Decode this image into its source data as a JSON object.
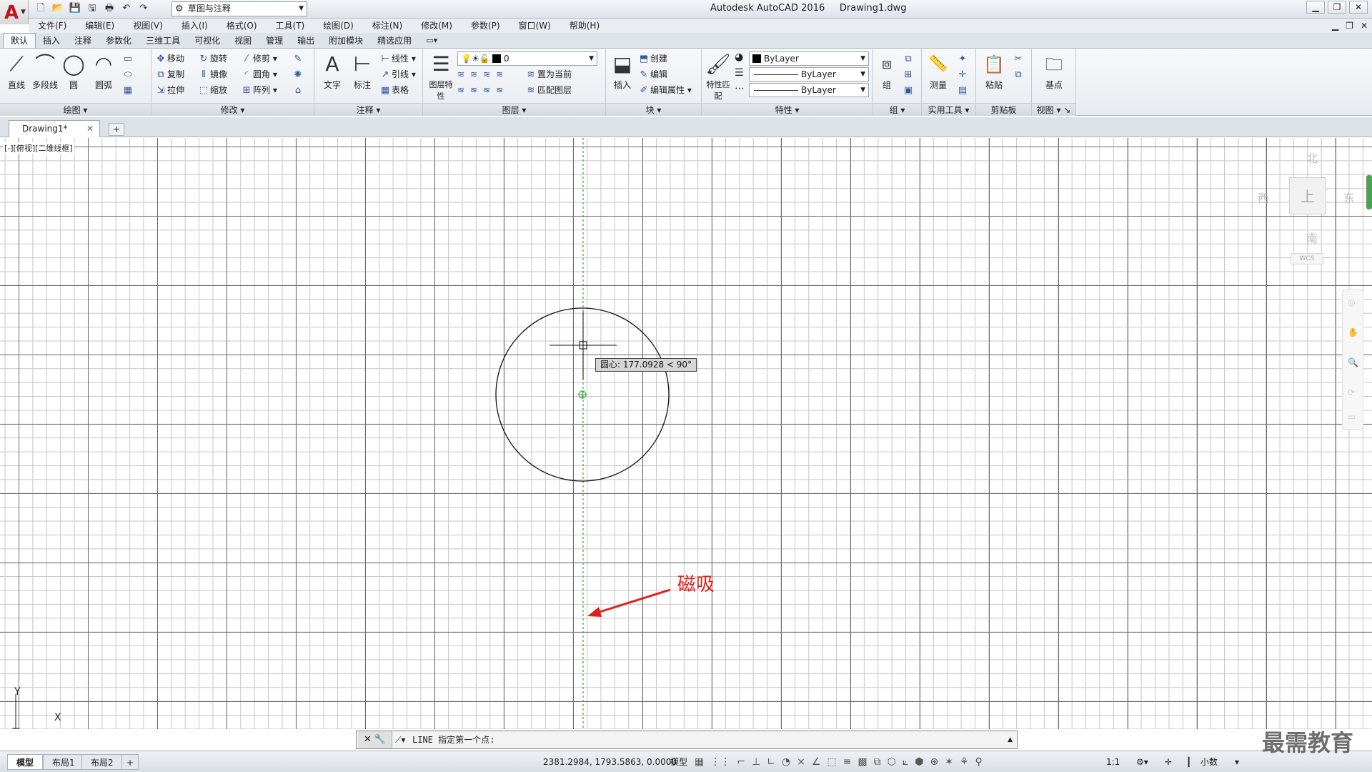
{
  "titlebar": {
    "workspace": "草图与注释",
    "app_name": "Autodesk AutoCAD 2016",
    "doc_name": "Drawing1.dwg"
  },
  "menu": [
    "文件(F)",
    "编辑(E)",
    "视图(V)",
    "插入(I)",
    "格式(O)",
    "工具(T)",
    "绘图(D)",
    "标注(N)",
    "修改(M)",
    "参数(P)",
    "窗口(W)",
    "帮助(H)"
  ],
  "ribbon_tabs": [
    "默认",
    "插入",
    "注释",
    "参数化",
    "三维工具",
    "可视化",
    "视图",
    "管理",
    "输出",
    "附加模块",
    "精选应用"
  ],
  "ribbon": {
    "draw": {
      "title": "绘图",
      "line": "直线",
      "polyline": "多段线",
      "circle": "圆",
      "arc": "圆弧"
    },
    "modify": {
      "title": "修改",
      "move": "移动",
      "rotate": "旋转",
      "trim": "修剪",
      "copy": "复制",
      "mirror": "镜像",
      "fillet": "圆角",
      "stretch": "拉伸",
      "scale": "缩放",
      "array": "阵列"
    },
    "annotation": {
      "title": "注释",
      "text": "文字",
      "dim": "标注",
      "linear": "线性",
      "leader": "引线",
      "table": "表格"
    },
    "layers": {
      "title": "图层",
      "props": "图层特性",
      "layer_name": "0",
      "set_current": "置为当前",
      "match": "匹配图层"
    },
    "block": {
      "title": "块",
      "insert": "插入",
      "create": "创建",
      "edit": "编辑",
      "edit_attr": "编辑属性"
    },
    "properties": {
      "title": "特性",
      "match": "特性匹配",
      "color": "ByLayer",
      "linetype": "ByLayer",
      "lineweight": "ByLayer"
    },
    "groups": {
      "title": "组",
      "group": "组"
    },
    "utilities": {
      "title": "实用工具",
      "measure": "测量"
    },
    "clipboard": {
      "title": "剪贴板",
      "paste": "粘贴"
    },
    "view": {
      "title": "视图",
      "base": "基点"
    }
  },
  "doc_tab": "Drawing1*",
  "canvas": {
    "view_label": "[-][俯视][二维线框]",
    "viewcube": {
      "n": "北",
      "s": "南",
      "w": "西",
      "e": "东",
      "top": "上",
      "wcs": "WCS"
    },
    "tooltip": "圆心: 177.0928 < 90°",
    "annotation": "磁吸",
    "ucs_x": "X",
    "ucs_y": "Y"
  },
  "command_line": "LINE 指定第一个点:",
  "status": {
    "layouts": [
      "模型",
      "布局1",
      "布局2"
    ],
    "coords": "2381.2984, 1793.5863, 0.0000",
    "model": "模型",
    "scale": "1:1",
    "units": "小数"
  },
  "watermark": "最需教育",
  "colors": {
    "accent": "#c0141c",
    "annotation": "#e0201a",
    "tracking": "#2fa82f"
  }
}
